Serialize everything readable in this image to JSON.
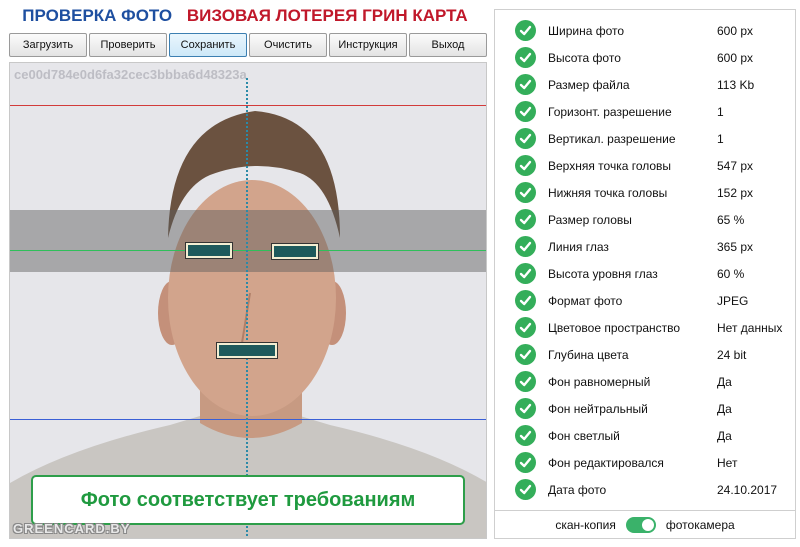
{
  "header": {
    "title_left": "ПРОВЕРКА ФОТО",
    "title_right": "ВИЗОВАЯ ЛОТЕРЕЯ ГРИН КАРТА"
  },
  "toolbar": {
    "load": "Загрузить",
    "check": "Проверить",
    "save": "Сохранить",
    "clear": "Очистить",
    "help": "Инструкция",
    "exit": "Выход"
  },
  "photo": {
    "hash": "ce00d784e0d6fa32cec3bbba6d48323a",
    "verdict": "Фото соответствует требованиям",
    "watermark": "GREENCARD.BY"
  },
  "checks": [
    {
      "label": "Ширина фото",
      "value": "600 px"
    },
    {
      "label": "Высота фото",
      "value": "600 px"
    },
    {
      "label": "Размер файла",
      "value": "113 Kb"
    },
    {
      "label": "Горизонт. разрешение",
      "value": "1"
    },
    {
      "label": "Вертикал. разрешение",
      "value": "1"
    },
    {
      "label": "Верхняя точка головы",
      "value": "547 px"
    },
    {
      "label": "Нижняя точка головы",
      "value": "152 px"
    },
    {
      "label": "Размер головы",
      "value": "65 %"
    },
    {
      "label": "Линия глаз",
      "value": "365 px"
    },
    {
      "label": "Высота уровня глаз",
      "value": "60 %"
    },
    {
      "label": "Формат фото",
      "value": "JPEG"
    },
    {
      "label": "Цветовое пространство",
      "value": "Нет данных"
    },
    {
      "label": "Глубина цвета",
      "value": "24 bit"
    },
    {
      "label": "Фон равномерный",
      "value": "Да"
    },
    {
      "label": "Фон нейтральный",
      "value": "Да"
    },
    {
      "label": "Фон светлый",
      "value": "Да"
    },
    {
      "label": "Фон редактировался",
      "value": "Нет"
    },
    {
      "label": "Дата фото",
      "value": "24.10.2017"
    }
  ],
  "mode": {
    "left_label": "скан-копия",
    "right_label": "фотокамера",
    "selected": "фотокамера"
  },
  "colors": {
    "check_ok": "#34ae5a",
    "title_blue": "#1e4fa0",
    "title_red": "#c0182a",
    "verdict_green": "#1f9a3f"
  }
}
